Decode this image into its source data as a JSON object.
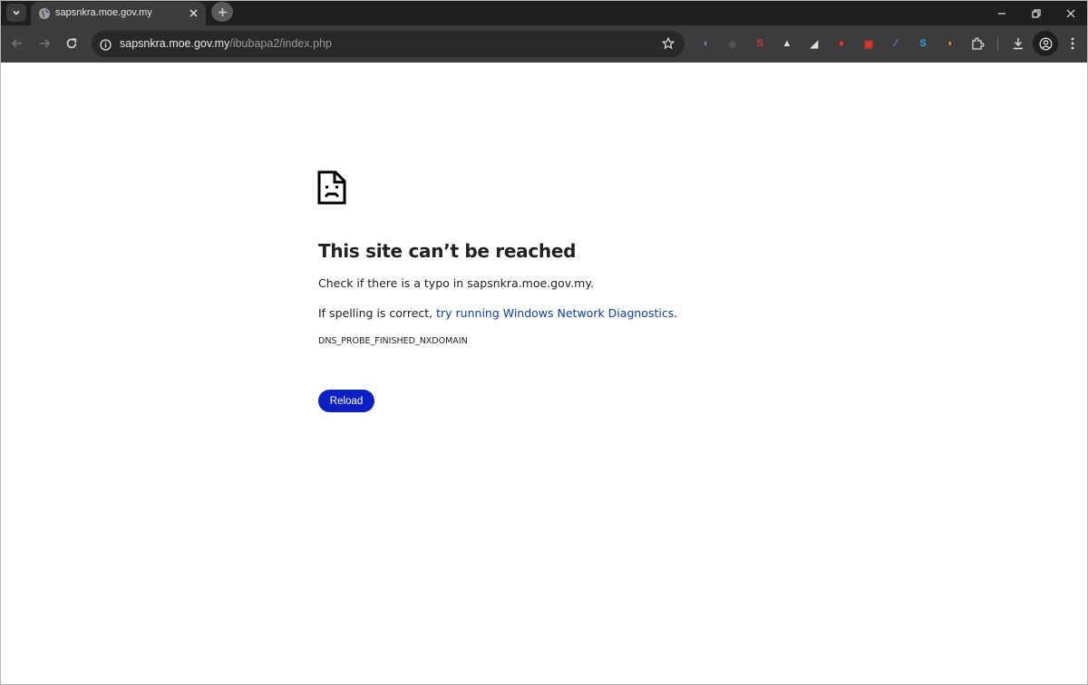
{
  "browser": {
    "tab": {
      "title": "sapsnkra.moe.gov.my"
    },
    "address_bar": {
      "host": "sapsnkra.moe.gov.my",
      "path": "/ibubapa2/index.php"
    },
    "extensions": [
      {
        "name": "extension-1-icon",
        "glyph": "◐",
        "color": "#6a88c8"
      },
      {
        "name": "extension-2-icon",
        "glyph": "◆",
        "color": "#555555"
      },
      {
        "name": "extension-3-icon",
        "glyph": "S",
        "color": "#d63a2f"
      },
      {
        "name": "extension-4-icon",
        "glyph": "▲",
        "color": "#e0e0e0"
      },
      {
        "name": "extension-5-icon",
        "glyph": "◢",
        "color": "#e0e0e0"
      },
      {
        "name": "extension-6-icon",
        "glyph": "●",
        "color": "#e8332b"
      },
      {
        "name": "extension-7-icon",
        "glyph": "▣",
        "color": "#e8332b"
      },
      {
        "name": "extension-8-icon",
        "glyph": "∕",
        "color": "#9b6ee0"
      },
      {
        "name": "extension-9-icon",
        "glyph": "S",
        "color": "#2aa6e0"
      },
      {
        "name": "extension-10-icon",
        "glyph": "◗",
        "color": "#f0a020"
      }
    ]
  },
  "error_page": {
    "heading": "This site can’t be reached",
    "line1": "Check if there is a typo in sapsnkra.moe.gov.my.",
    "line2_prefix": "If spelling is correct, ",
    "line2_link": "try running Windows Network Diagnostics",
    "line2_suffix": ".",
    "error_code": "DNS_PROBE_FINISHED_NXDOMAIN",
    "reload_label": "Reload"
  },
  "colors": {
    "accent": "#0b1fc2",
    "link": "#0b3db3",
    "chrome_dark": "#1f1f1f",
    "toolbar": "#3c3c3c"
  }
}
